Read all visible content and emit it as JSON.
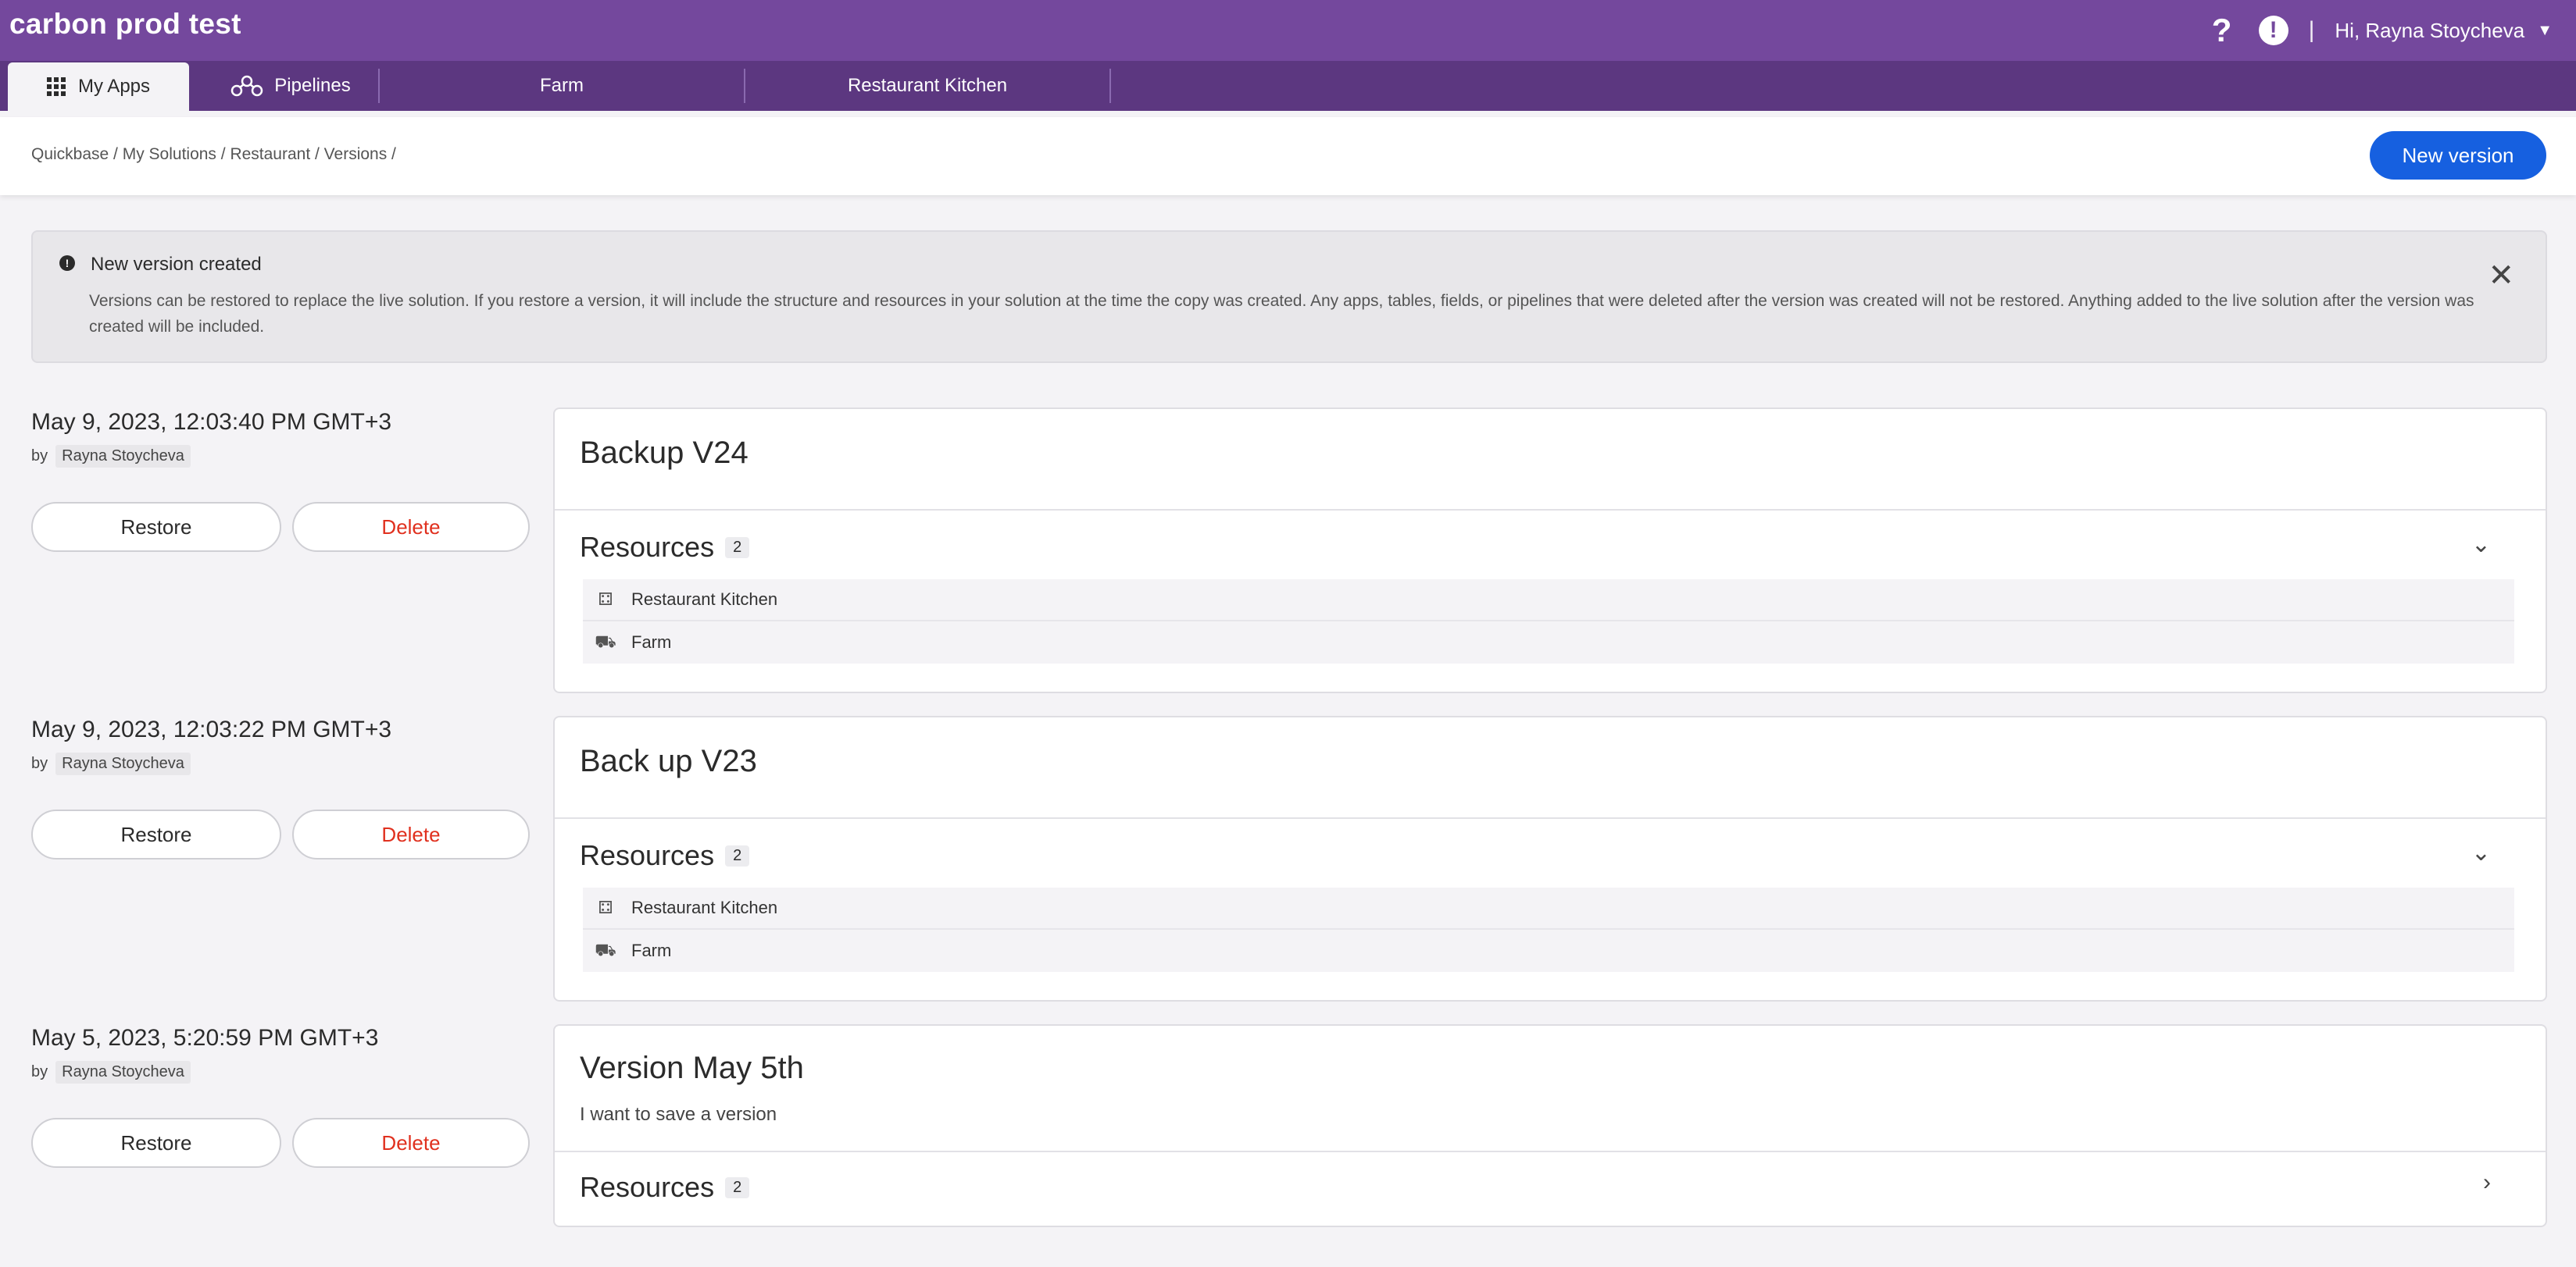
{
  "app": {
    "title": "carbon prod test",
    "user_greeting": "Hi, Rayna Stoycheva",
    "help_glyph": "?",
    "alert_glyph": "!",
    "separator": "|"
  },
  "tabs": [
    {
      "label": "My Apps",
      "icon": "grid-icon"
    },
    {
      "label": "Pipelines",
      "icon": "pipelines-icon"
    },
    {
      "label": "Farm"
    },
    {
      "label": "Restaurant Kitchen"
    }
  ],
  "breadcrumb": "Quickbase / My Solutions / Restaurant / Versions /",
  "new_version_label": "New version",
  "banner": {
    "title": "New version created",
    "text": "Versions can be restored to replace the live solution. If you restore a version, it will include the structure and resources in your solution at the time the copy was created. Any apps, tables, fields, or pipelines that were deleted after the version was created will not be restored. Anything added to the live solution after the version was created will be included."
  },
  "by_label": "by",
  "restore_label": "Restore",
  "delete_label": "Delete",
  "resources_label": "Resources",
  "versions": [
    {
      "date": "May 9, 2023, 12:03:40 PM GMT+3",
      "user": "Rayna Stoycheva",
      "title": "Backup V24",
      "description": "",
      "resource_count": "2",
      "expanded": true,
      "resources": [
        {
          "name": "Restaurant Kitchen",
          "icon": "kitchen-app-icon"
        },
        {
          "name": "Farm",
          "icon": "farm-app-icon"
        }
      ]
    },
    {
      "date": "May 9, 2023, 12:03:22 PM GMT+3",
      "user": "Rayna Stoycheva",
      "title": "Back up V23",
      "description": "",
      "resource_count": "2",
      "expanded": true,
      "resources": [
        {
          "name": "Restaurant Kitchen",
          "icon": "kitchen-app-icon"
        },
        {
          "name": "Farm",
          "icon": "farm-app-icon"
        }
      ]
    },
    {
      "date": "May 5, 2023, 5:20:59 PM GMT+3",
      "user": "Rayna Stoycheva",
      "title": "Version May 5th",
      "description": "I want to save a version",
      "resource_count": "2",
      "expanded": false,
      "resources": []
    }
  ],
  "colors": {
    "topbar": "#74489d",
    "tabbar": "#5c3780",
    "primary_button": "#1660e0",
    "delete_text": "#e0301e"
  }
}
